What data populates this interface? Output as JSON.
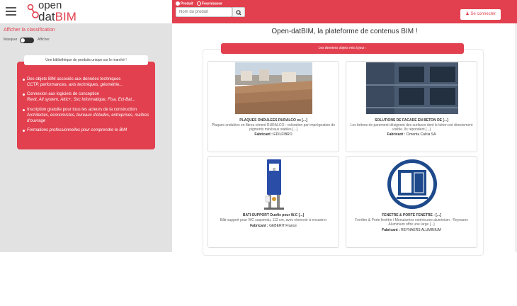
{
  "header": {
    "logo_line1": "open",
    "logo_line2_a": "dat",
    "logo_line2_b": "BIM",
    "radio_produit": "Produit",
    "radio_fournisseur": "Fournisseur",
    "search_placeholder": "Nom du produit",
    "login_label": "Se connecter"
  },
  "sidebar": {
    "classification_link": "Afficher la classification",
    "hide_label": "Masquer",
    "show_label": "Afficher",
    "tagline": "Une bibliothèque de produits unique sur le marché !",
    "promo": [
      {
        "title": "Des objets BIM associés aux données techniques",
        "detail": "CCTP, performances, avis techniques, géométrie..."
      },
      {
        "title": "Connexion aux logiciels de conception",
        "detail": "Revit, All system, Attic+, Sxc Informatique, Fisa, Ecl-Bat..."
      },
      {
        "title": "Inscription gratuite pour tous les acteurs de la construction",
        "detail": "Architectes, économistes, bureaux d'études, entreprises, maîtres d'ouvrage"
      },
      {
        "title": "",
        "detail": "Formations professionnelles pour comprendre le BIM"
      }
    ]
  },
  "main": {
    "title": "Open-datBIM, la plateforme de contenus BIM !",
    "latest_label": "Les derniers objets mis à jour :",
    "fab_prefix": "Fabricant :",
    "cards": [
      {
        "title": "PLAQUES ONDULEES RURALCO es [...]",
        "desc": "Plaques ondulées en fibres-ciment RURALCO : coloration par imprégnation de pigments minéraux stables [...]",
        "maker": "EDILFIBRO"
      },
      {
        "title": "SOLUTIONS DE FACADE EN BETON DE [...]",
        "desc": "Les bétons de parement désignent des surfaces dont le béton est directement visible. Ils répondent [...]",
        "maker": "Cimenta Calcia SA"
      },
      {
        "title": "BATI-SUPPORT Duofix pour W.C [...]",
        "desc": "Bâti-support pour WC suspendu, 112 cm, avec réservoir à encastrer",
        "maker": "GEBERIT France"
      },
      {
        "title": "FENETRE & PORTE FENETRE - [...]",
        "desc": "Fenêtre & Porte fenêtre / Menuiseries extérieures aluminium - Reynaers Aluminium offre une large [...]",
        "maker": "REYNAERS ALUMINIUM"
      }
    ]
  }
}
